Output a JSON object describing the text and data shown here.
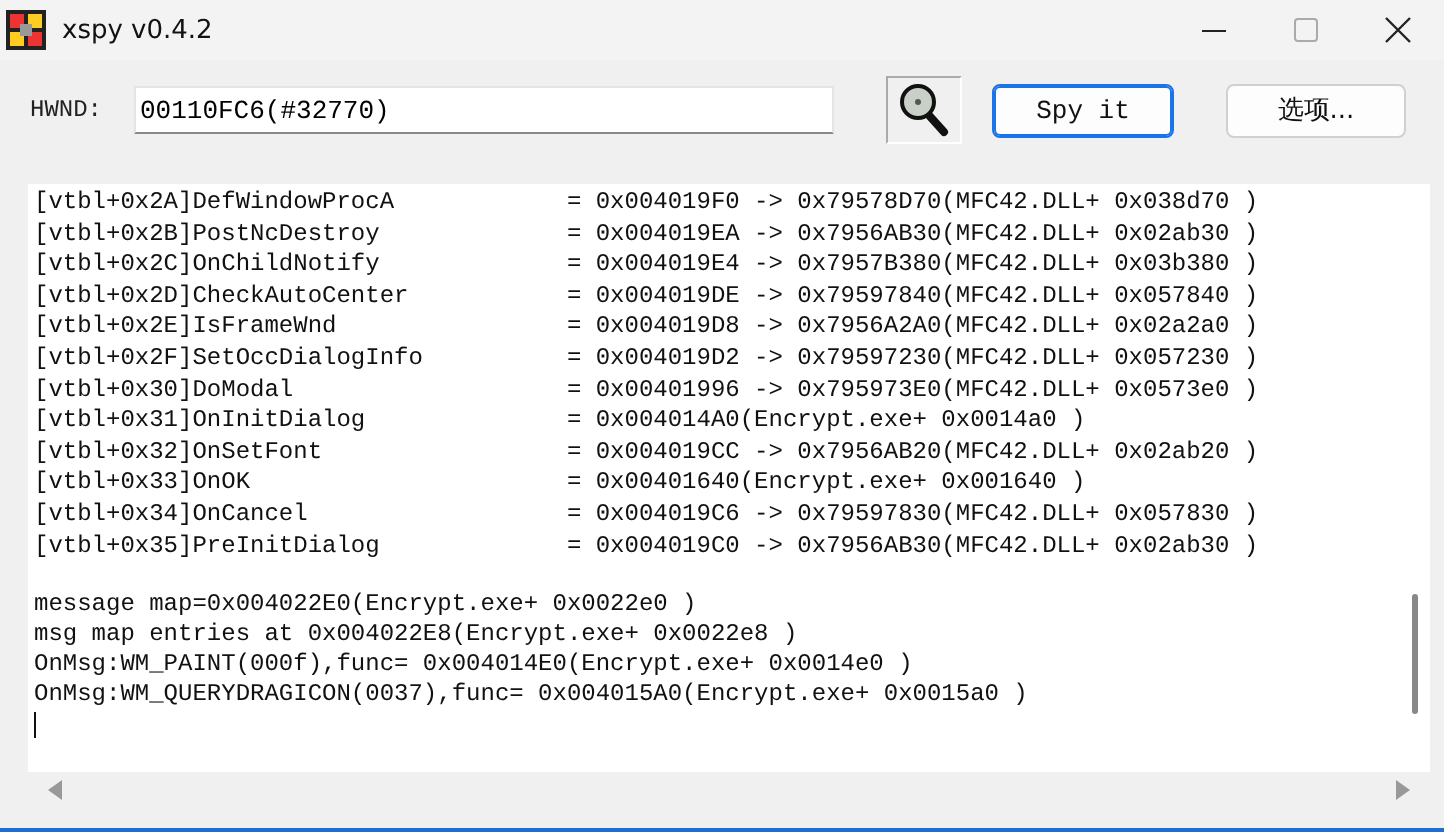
{
  "window": {
    "title": "xspy v0.4.2"
  },
  "toolbar": {
    "hwnd_label": "HWND:",
    "hwnd_value": "00110FC6(#32770)",
    "buttons": [
      {
        "label": "Spy it",
        "default": true
      },
      {
        "label": "选项...",
        "default": false
      }
    ]
  },
  "output": {
    "vtable_lines": [
      "[vtbl+0x2A]DefWindowProcA            = 0x004019F0 -> 0x79578D70(MFC42.DLL+ 0x038d70 )",
      "[vtbl+0x2B]PostNcDestroy             = 0x004019EA -> 0x7956AB30(MFC42.DLL+ 0x02ab30 )",
      "[vtbl+0x2C]OnChildNotify             = 0x004019E4 -> 0x7957B380(MFC42.DLL+ 0x03b380 )",
      "[vtbl+0x2D]CheckAutoCenter           = 0x004019DE -> 0x79597840(MFC42.DLL+ 0x057840 )",
      "[vtbl+0x2E]IsFrameWnd                = 0x004019D8 -> 0x7956A2A0(MFC42.DLL+ 0x02a2a0 )",
      "[vtbl+0x2F]SetOccDialogInfo          = 0x004019D2 -> 0x79597230(MFC42.DLL+ 0x057230 )",
      "[vtbl+0x30]DoModal                   = 0x00401996 -> 0x795973E0(MFC42.DLL+ 0x0573e0 )",
      "[vtbl+0x31]OnInitDialog              = 0x004014A0(Encrypt.exe+ 0x0014a0 )",
      "[vtbl+0x32]OnSetFont                 = 0x004019CC -> 0x7956AB20(MFC42.DLL+ 0x02ab20 )",
      "[vtbl+0x33]OnOK                      = 0x00401640(Encrypt.exe+ 0x001640 )",
      "[vtbl+0x34]OnCancel                  = 0x004019C6 -> 0x79597830(MFC42.DLL+ 0x057830 )",
      "[vtbl+0x35]PreInitDialog             = 0x004019C0 -> 0x7956AB30(MFC42.DLL+ 0x02ab30 )"
    ],
    "message_lines": [
      "message map=0x004022E0(Encrypt.exe+ 0x0022e0 )",
      "msg map entries at 0x004022E8(Encrypt.exe+ 0x0022e8 )",
      "OnMsg:WM_PAINT(000f),func= 0x004014E0(Encrypt.exe+ 0x0014e0 )",
      "OnMsg:WM_QUERYDRAGICON(0037),func= 0x004015A0(Encrypt.exe+ 0x0015a0 )"
    ]
  }
}
